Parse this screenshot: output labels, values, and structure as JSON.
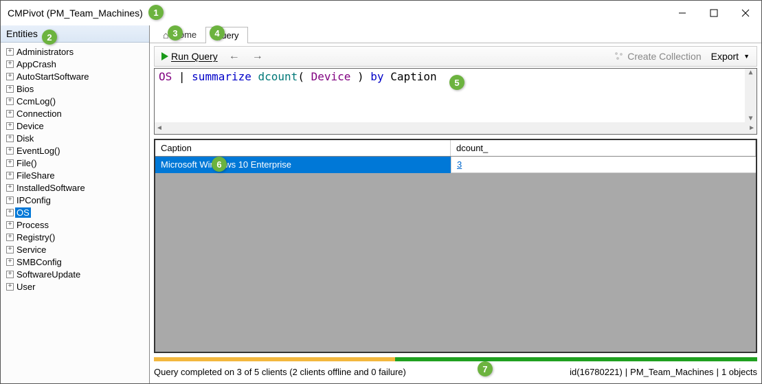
{
  "window": {
    "title": "CMPivot (PM_Team_Machines)"
  },
  "sidebar": {
    "header": "Entities",
    "items": [
      {
        "label": "Administrators"
      },
      {
        "label": "AppCrash"
      },
      {
        "label": "AutoStartSoftware"
      },
      {
        "label": "Bios"
      },
      {
        "label": "CcmLog()"
      },
      {
        "label": "Connection"
      },
      {
        "label": "Device"
      },
      {
        "label": "Disk"
      },
      {
        "label": "EventLog()"
      },
      {
        "label": "File()"
      },
      {
        "label": "FileShare"
      },
      {
        "label": "InstalledSoftware"
      },
      {
        "label": "IPConfig"
      },
      {
        "label": "OS"
      },
      {
        "label": "Process"
      },
      {
        "label": "Registry()"
      },
      {
        "label": "Service"
      },
      {
        "label": "SMBConfig"
      },
      {
        "label": "SoftwareUpdate"
      },
      {
        "label": "User"
      }
    ],
    "selected_index": 13
  },
  "tabs": {
    "home": "Home",
    "query": "Query",
    "active": "query"
  },
  "toolbar": {
    "run": "Run Query",
    "create_collection": "Create Collection",
    "export": "Export"
  },
  "query": {
    "tok_os": "OS",
    "tok_sep1": " | ",
    "tok_summarize": "summarize",
    "tok_sp1": " ",
    "tok_dcount": "dcount",
    "tok_open": "( ",
    "tok_device": "Device",
    "tok_close": " ) ",
    "tok_by": "by",
    "tok_sp2": " ",
    "tok_caption": "Caption"
  },
  "results": {
    "columns": {
      "c1": "Caption",
      "c2": "dcount_"
    },
    "rows": [
      {
        "caption": "Microsoft Windows 10 Enterprise",
        "dcount": "3"
      }
    ]
  },
  "progress": {
    "offline_pct": 40,
    "ok_pct": 60
  },
  "status": {
    "message": "Query completed on 3 of 5 clients (2 clients offline and 0 failure)",
    "id": "id(16780221)",
    "sep": "|",
    "collection": "PM_Team_Machines",
    "objects": "1 objects"
  },
  "callouts": {
    "1": "1",
    "2": "2",
    "3": "3",
    "4": "4",
    "5": "5",
    "6": "6",
    "7": "7"
  }
}
